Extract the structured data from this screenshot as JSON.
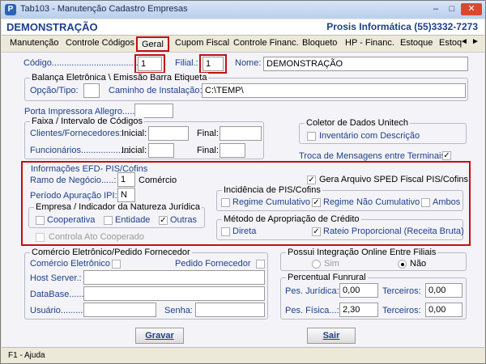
{
  "window": {
    "title": "Tab103 - Manutenção Cadastro Empresas",
    "app_icon": "P"
  },
  "header": {
    "company": "DEMONSTRAÇÃO",
    "vendor": "Prosis Informática (55)3332-7273"
  },
  "tabs": [
    "Manutenção",
    "Controle Códigos",
    "Geral",
    "Cupom Fiscal",
    "Controle Financ.",
    "Bloqueto",
    "HP - Financ.",
    "Estoque",
    "Estoq"
  ],
  "active_tab": "Geral",
  "main": {
    "codigo_label": "Código............................................",
    "codigo_value": "1",
    "filial_label": "Filial.:",
    "filial_value": "1",
    "nome_label": "Nome:",
    "nome_value": "DEMONSTRAÇÃO"
  },
  "balanca": {
    "title": "Balança Eletrônica \\ Emissão Barra Etiqueta",
    "opcao_label": "Opção/Tipo:",
    "opcao_value": "",
    "caminho_label": "Caminho de Instalação:",
    "caminho_value": "C:\\TEMP\\"
  },
  "porta": {
    "label": "Porta Impressora Allegro.....:",
    "value": ""
  },
  "faixa": {
    "title": "Faixa / Intervalo de Códigos",
    "clientes_label": "Clientes/Fornecedores:",
    "funcionarios_label": "Funcionários...................:",
    "inicial_label": "Inicial:",
    "final_label": "Final:"
  },
  "coletor": {
    "title": "Coletor de Dados Unitech",
    "inventario_label": "Inventário com Descrição",
    "inventario_checked": false
  },
  "troca": {
    "label": "Troca de Mensagens entre Terminais",
    "checked": true
  },
  "efd": {
    "title": "Informações EFD- PIS/Cofins",
    "ramo_label": "Ramo de Negócio.....:",
    "ramo_value": "1",
    "ramo_desc": "Comércio",
    "periodo_label": "Período Apuração IPI:",
    "periodo_value": "N",
    "gera_label": "Gera Arquivo SPED Fiscal PIS/Cofins",
    "gera_checked": true,
    "natureza_title": "Empresa / Indicador da Natureza Jurídica",
    "cooperativa": "Cooperativa",
    "entidade": "Entidade",
    "outras": "Outras",
    "outras_checked": true,
    "controla_label": "Controla Ato Cooperado",
    "incidencia_title": "Incidência de PIS/Cofins",
    "regime_cumulativo": "Regime Cumulativo",
    "regime_nao_cumulativo": "Regime Não Cumulativo",
    "ambos": "Ambos",
    "metodo_title": "Método de Apropriação de Crédito",
    "direta": "Direta",
    "rateio": "Rateio Proporcional (Receita Bruta)"
  },
  "comercio": {
    "title": "Comércio Eletrônico/Pedido Fornecedor",
    "comercio_label": "Comércio Eletrônico",
    "pedido_label": "Pedido Fornecedor",
    "host_label": "Host Server.:",
    "database_label": "DataBase.......:",
    "usuario_label": "Usuário.........:",
    "senha_label": "Senha:"
  },
  "integracao": {
    "title": "Possui Integração Online Entre Filiais",
    "sim": "Sim",
    "nao": "Não",
    "selected": "Não"
  },
  "funrural": {
    "title": "Percentual Funrural",
    "pes_juridica_label": "Pes. Jurídica:",
    "pes_juridica_value": "0,00",
    "pes_fisica_label": "Pes. Física...:",
    "pes_fisica_value": "2,30",
    "terceiros_label": "Terceiros:",
    "terceiros_juridica_value": "0,00",
    "terceiros_fisica_value": "0,00"
  },
  "buttons": {
    "gravar": "Gravar",
    "sair": "Sair"
  },
  "statusbar": {
    "text": "F1 - Ajuda"
  },
  "colors": {
    "accent_blue": "#1d3f8a",
    "highlight_red": "#c01010"
  }
}
